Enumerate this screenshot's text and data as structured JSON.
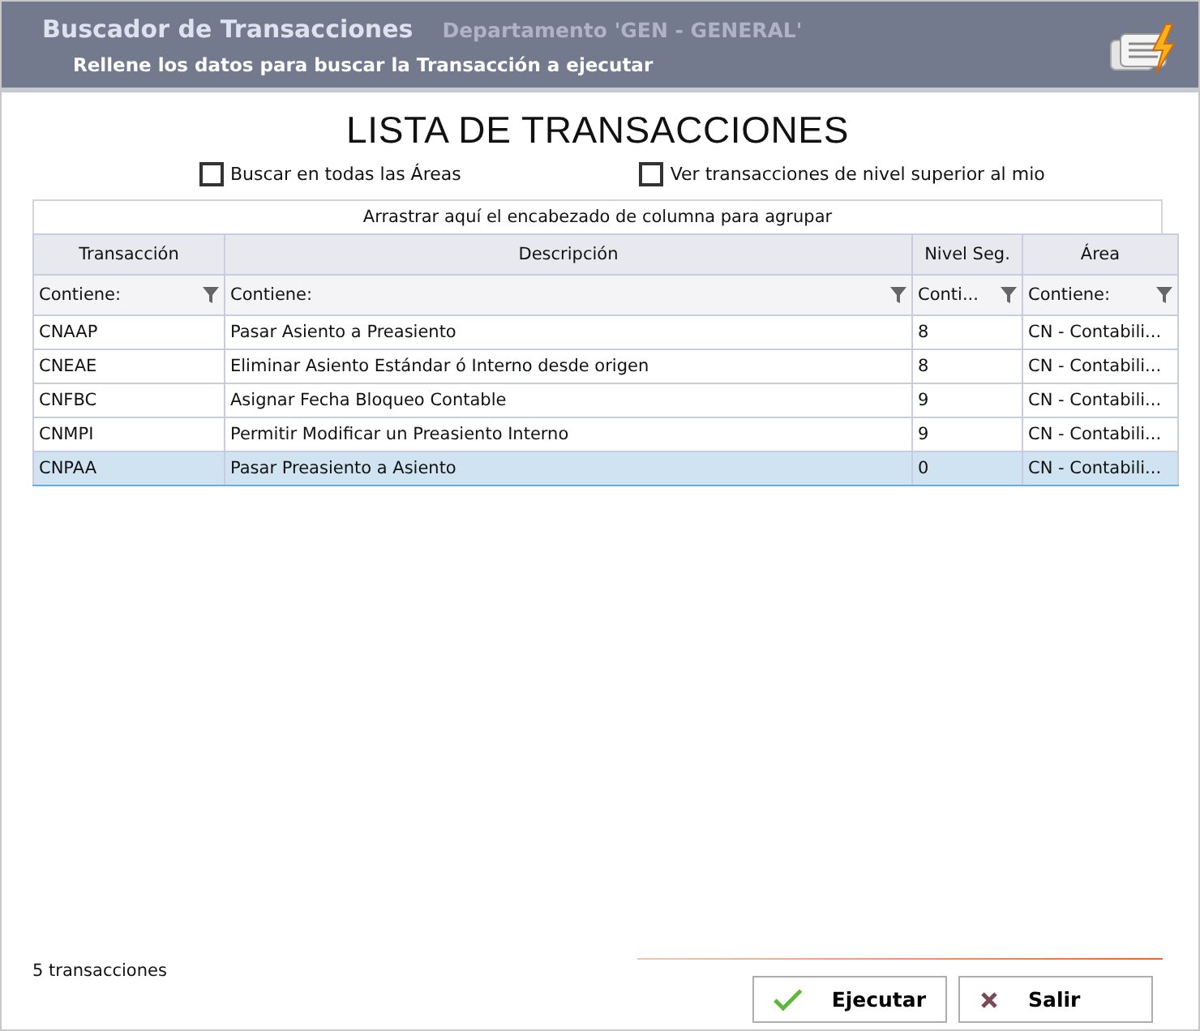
{
  "header": {
    "title": "Buscador de Transacciones",
    "department": "Departamento 'GEN - GENERAL'",
    "subtitle": "Rellene los datos para buscar la Transacción a ejecutar"
  },
  "heading": "LISTA DE TRANSACCIONES",
  "options": [
    {
      "label": "Buscar en todas las Áreas",
      "checked": false
    },
    {
      "label": "Ver transacciones de nivel superior al mio",
      "checked": false
    }
  ],
  "group_panel": "Arrastrar aquí el encabezado de columna para agrupar",
  "table": {
    "columns": [
      {
        "title": "Transacción",
        "filter": "Contiene:"
      },
      {
        "title": "Descripción",
        "filter": "Contiene:"
      },
      {
        "title": "Nivel Seg.",
        "filter": "Conti..."
      },
      {
        "title": "Área",
        "filter": "Contiene:"
      }
    ],
    "rows": [
      {
        "cells": [
          "CNAAP",
          "Pasar Asiento a Preasiento",
          "8",
          "CN - Contabili..."
        ],
        "selected": false
      },
      {
        "cells": [
          "CNEAE",
          "Eliminar Asiento Estándar ó Interno desde origen",
          "8",
          "CN - Contabili..."
        ],
        "selected": false
      },
      {
        "cells": [
          "CNFBC",
          "Asignar Fecha Bloqueo Contable",
          "9",
          "CN - Contabili..."
        ],
        "selected": false
      },
      {
        "cells": [
          "CNMPI",
          "Permitir Modificar un Preasiento Interno",
          "9",
          "CN - Contabili..."
        ],
        "selected": false
      },
      {
        "cells": [
          "CNPAA",
          "Pasar Preasiento a Asiento",
          "0",
          "CN - Contabili..."
        ],
        "selected": true
      }
    ]
  },
  "status": "5 transacciones",
  "buttons": [
    {
      "label": "Ejecutar",
      "kind": "ok"
    },
    {
      "label": "Salir",
      "kind": "cancel"
    }
  ]
}
